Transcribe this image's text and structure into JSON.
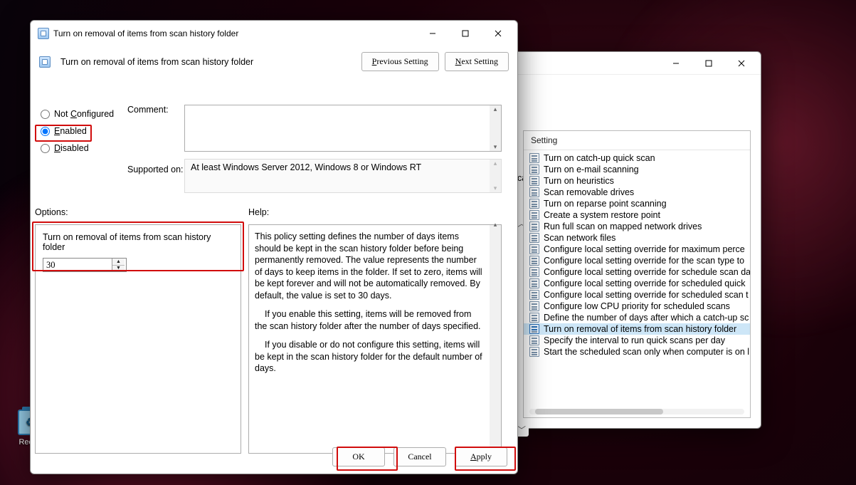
{
  "desktop": {
    "recycle_label": "Recycl"
  },
  "bg_window": {
    "header": "Setting",
    "left_tab": "can",
    "items": [
      "Turn on catch-up quick scan",
      "Turn on e-mail scanning",
      "Turn on heuristics",
      "Scan removable drives",
      "Turn on reparse point scanning",
      "Create a system restore point",
      "Run full scan on mapped network drives",
      "Scan network files",
      "Configure local setting override for maximum perce",
      "Configure local setting override for the scan type to",
      "Configure local setting override for schedule scan da",
      "Configure local setting override for scheduled quick",
      "Configure local setting override for scheduled scan t",
      "Configure low CPU priority for scheduled scans",
      "Define the number of days after which a catch-up sc",
      "Turn on removal of items from scan history folder",
      "Specify the interval to run quick scans per day",
      "Start the scheduled scan only when computer is on l"
    ],
    "selected_index": 15
  },
  "fg_window": {
    "title": "Turn on removal of items from scan history folder",
    "subtitle": "Turn on removal of items from scan history folder",
    "nav": {
      "prev": "Previous Setting",
      "next": "Next Setting"
    },
    "radios": {
      "not_configured": "Not Configured",
      "enabled": "Enabled",
      "disabled": "Disabled",
      "selected": "enabled"
    },
    "labels": {
      "comment": "Comment:",
      "supported": "Supported on:",
      "options": "Options:",
      "help": "Help:"
    },
    "supported_text": "At least Windows Server 2012, Windows 8 or Windows RT",
    "option": {
      "label": "Turn on removal of items from scan history folder",
      "value": "30"
    },
    "help": {
      "p1": "This policy setting defines the number of days items should be kept in the scan history folder before being permanently removed. The value represents the number of days to keep items in the folder. If set to zero, items will be kept forever and will not be automatically removed. By default, the value is set to 30 days.",
      "p2": "If you enable this setting, items will be removed from the scan history folder after the number of days specified.",
      "p3": "If you disable or do not configure this setting, items will be kept in the scan history folder for the default number of days."
    },
    "buttons": {
      "ok": "OK",
      "cancel": "Cancel",
      "apply": "Apply"
    }
  }
}
